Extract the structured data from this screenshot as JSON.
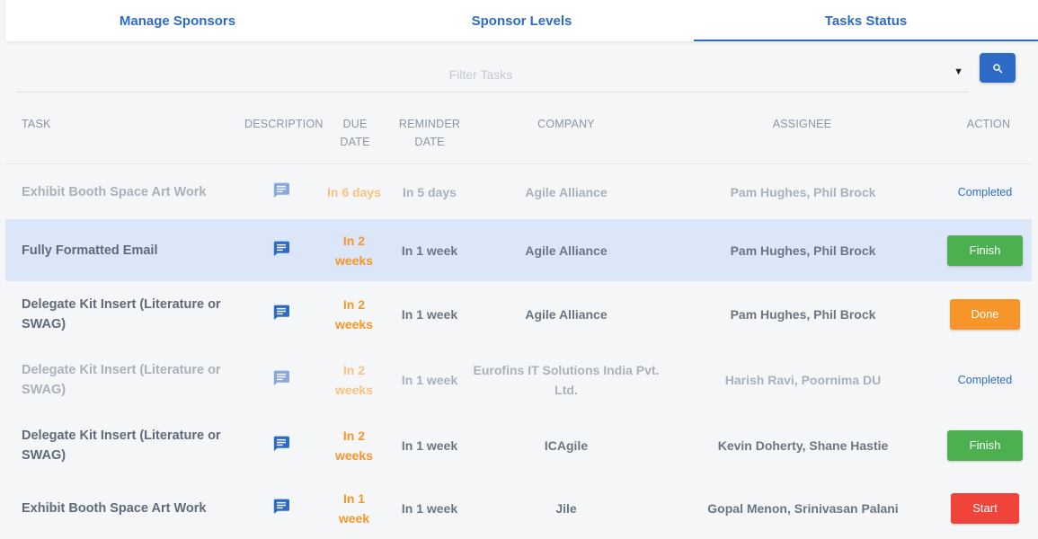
{
  "tabs": [
    {
      "label": "Manage Sponsors"
    },
    {
      "label": "Sponsor Levels"
    },
    {
      "label": "Tasks Status"
    }
  ],
  "filter": {
    "placeholder": "Filter Tasks"
  },
  "columns": {
    "task": "TASK",
    "description": "DESCRIPTION",
    "due_date": [
      "DUE",
      "DATE"
    ],
    "reminder_date": [
      "REMINDER",
      "DATE"
    ],
    "company": "COMPANY",
    "assignee": "ASSIGNEE",
    "action": "ACTION"
  },
  "icons": {
    "description": "comment-icon",
    "search": "search-icon",
    "dropdown": "caret-down-icon"
  },
  "colors": {
    "accent": "#2e6bc6",
    "due": "#f6962a",
    "finish": "#4caf50",
    "done": "#f6962a",
    "start": "#f0443a",
    "highlight": "#dbe6f8"
  },
  "rows": [
    {
      "task": [
        "Exhibit Booth Space Art Work"
      ],
      "due": [
        "In 6 days"
      ],
      "reminder": "In 5 days",
      "company": [
        "Agile Alliance"
      ],
      "assignee": "Pam Hughes, Phil Brock",
      "action": "Completed"
    },
    {
      "task": [
        "Fully Formatted Email"
      ],
      "due": [
        "In 2",
        "weeks"
      ],
      "reminder": "In 1 week",
      "company": [
        "Agile Alliance"
      ],
      "assignee": "Pam Hughes, Phil Brock",
      "action": "Finish"
    },
    {
      "task": [
        "Delegate Kit Insert (Literature or",
        "SWAG)"
      ],
      "due": [
        "In 2",
        "weeks"
      ],
      "reminder": "In 1 week",
      "company": [
        "Agile Alliance"
      ],
      "assignee": "Pam Hughes, Phil Brock",
      "action": "Done"
    },
    {
      "task": [
        "Delegate Kit Insert (Literature or",
        "SWAG)"
      ],
      "due": [
        "In 2",
        "weeks"
      ],
      "reminder": "In 1 week",
      "company": [
        "Eurofins IT Solutions India Pvt.",
        "Ltd."
      ],
      "assignee": "Harish Ravi, Poornima DU",
      "action": "Completed"
    },
    {
      "task": [
        "Delegate Kit Insert (Literature or",
        "SWAG)"
      ],
      "due": [
        "In 2",
        "weeks"
      ],
      "reminder": "In 1 week",
      "company": [
        "ICAgile"
      ],
      "assignee": "Kevin Doherty, Shane Hastie",
      "action": "Finish"
    },
    {
      "task": [
        "Exhibit Booth Space Art Work"
      ],
      "due": [
        "In 1",
        "week"
      ],
      "reminder": "In 1 week",
      "company": [
        "Jile"
      ],
      "assignee": "Gopal Menon, Srinivasan Palani",
      "action": "Start"
    }
  ]
}
